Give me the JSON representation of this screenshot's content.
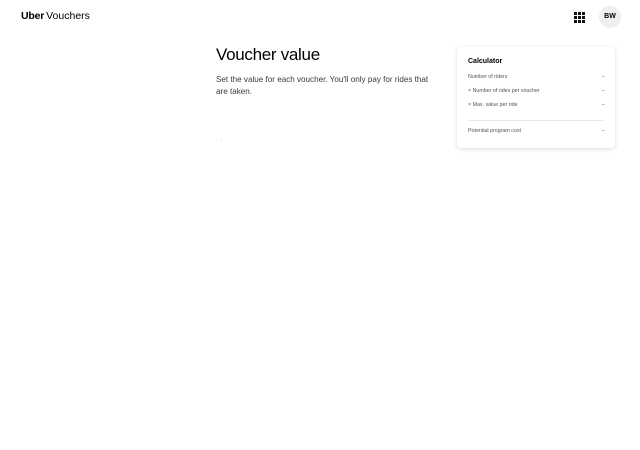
{
  "header": {
    "brand": "Uber",
    "product": "Vouchers",
    "avatar_initials": "BW",
    "apps_icon": "grid-icon"
  },
  "main": {
    "title": "Voucher value",
    "description": "Set the value for each voucher. You'll only pay for rides that are taken."
  },
  "calculator": {
    "title": "Calculator",
    "rows": [
      {
        "label": "Number of riders",
        "value": "--"
      },
      {
        "label": "× Number of rides per voucher",
        "value": "--"
      },
      {
        "label": "× Max. value per ride",
        "value": "--"
      }
    ],
    "total": {
      "label": "Potential program cost",
      "value": "--"
    }
  }
}
